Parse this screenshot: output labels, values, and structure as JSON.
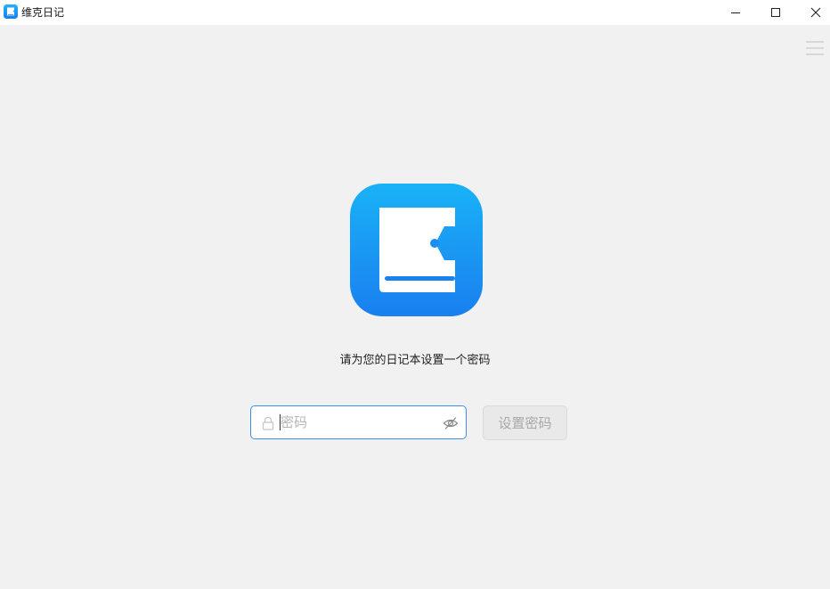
{
  "window": {
    "title": "维克日记",
    "accent_color": "#1e90f0"
  },
  "icons": {
    "app": "diary-book-icon",
    "minimize": "minimize-icon",
    "maximize": "maximize-icon",
    "close": "close-icon",
    "menu": "hamburger-menu-icon",
    "logo": "diary-book-logo",
    "lock": "lock-icon",
    "visibility": "eye-slash-icon"
  },
  "main": {
    "prompt": "请为您的日记本设置一个密码",
    "password_placeholder": "密码",
    "password_value": "",
    "set_button_label": "设置密码"
  }
}
